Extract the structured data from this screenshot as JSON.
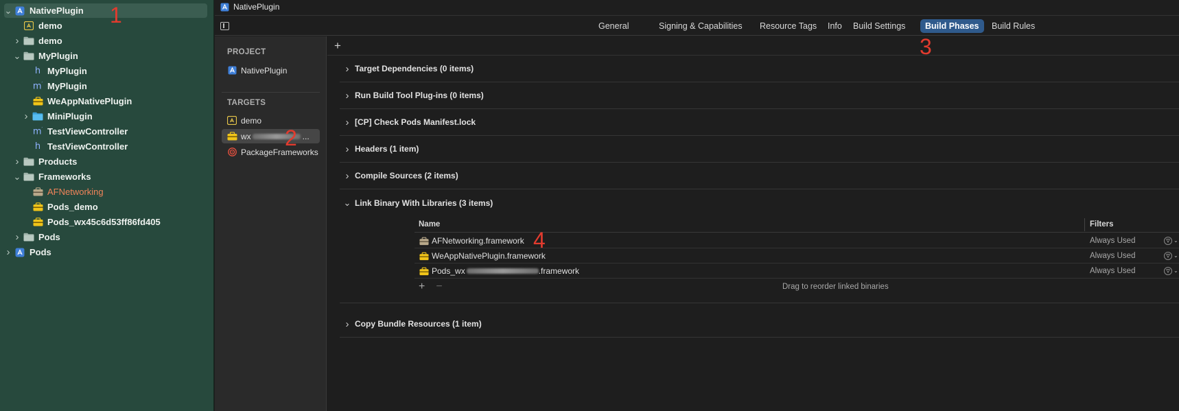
{
  "navigator": {
    "rows": [
      {
        "label": "NativePlugin",
        "chev": "down",
        "icon": "xcode-project-icon",
        "bold": true,
        "selected": true
      },
      {
        "label": "demo",
        "chev": "",
        "icon": "app-target-icon",
        "bold": true
      },
      {
        "label": "demo",
        "chev": "right",
        "icon": "folder-icon",
        "bold": true
      },
      {
        "label": "MyPlugin",
        "chev": "down",
        "icon": "folder-icon",
        "bold": true
      },
      {
        "label": "MyPlugin",
        "chev": "",
        "icon": "header-file-icon",
        "bold": true
      },
      {
        "label": "MyPlugin",
        "chev": "",
        "icon": "objc-file-icon",
        "bold": true
      },
      {
        "label": "WeAppNativePlugin",
        "chev": "",
        "icon": "framework-icon",
        "bold": true
      },
      {
        "label": "MiniPlugin",
        "chev": "right",
        "icon": "blue-folder-icon",
        "bold": true
      },
      {
        "label": "TestViewController",
        "chev": "",
        "icon": "objc-file-icon",
        "bold": true
      },
      {
        "label": "TestViewController",
        "chev": "",
        "icon": "header-file-icon",
        "bold": true
      },
      {
        "label": "Products",
        "chev": "right",
        "icon": "folder-icon",
        "bold": true
      },
      {
        "label": "Frameworks",
        "chev": "down",
        "icon": "folder-icon",
        "bold": true
      },
      {
        "label": "AFNetworking",
        "chev": "",
        "icon": "framework-gray-icon",
        "bold": false,
        "orange": true
      },
      {
        "label": "Pods_demo",
        "chev": "",
        "icon": "framework-icon",
        "bold": true
      },
      {
        "label": "Pods_wx45c6d53ff86fd405",
        "chev": "",
        "icon": "framework-icon",
        "bold": true
      },
      {
        "label": "Pods",
        "chev": "right",
        "icon": "folder-icon",
        "bold": true
      },
      {
        "label": "Pods",
        "chev": "right",
        "icon": "xcode-project-icon",
        "bold": true
      }
    ]
  },
  "header": {
    "title": "NativePlugin",
    "tabs": [
      "General",
      "Signing & Capabilities",
      "Resource Tags",
      "Info",
      "Build Settings",
      "Build Phases",
      "Build Rules"
    ],
    "active_tab": "Build Phases"
  },
  "targets_panel": {
    "project_heading": "PROJECT",
    "project_item": "NativePlugin",
    "targets_heading": "TARGETS",
    "targets": [
      {
        "label": "demo",
        "icon": "app-target-icon",
        "selected": false
      },
      {
        "label": "wx",
        "icon": "framework-icon",
        "selected": true,
        "redacted": true,
        "suffix": "..."
      },
      {
        "label": "PackageFrameworks",
        "icon": "aggregate-target-icon",
        "selected": false
      }
    ]
  },
  "build_phases": {
    "add_label": "+",
    "phases": [
      {
        "label": "Target Dependencies (0 items)",
        "expanded": false
      },
      {
        "label": "Run Build Tool Plug-ins (0 items)",
        "expanded": false
      },
      {
        "label": "[CP] Check Pods Manifest.lock",
        "expanded": false
      },
      {
        "label": "Headers (1 item)",
        "expanded": false
      },
      {
        "label": "Compile Sources (2 items)",
        "expanded": false
      },
      {
        "label": "Link Binary With Libraries (3 items)",
        "expanded": true
      },
      {
        "label": "Copy Bundle Resources (1 item)",
        "expanded": false
      }
    ],
    "link_table": {
      "col_name": "Name",
      "col_filters": "Filters",
      "rows": [
        {
          "name": "AFNetworking.framework",
          "status": "Always Used",
          "icon": "framework-gray-icon"
        },
        {
          "name": "WeAppNativePlugin.framework",
          "status": "Always Used",
          "icon": "framework-icon"
        },
        {
          "name": "Pods_wx",
          "name_suffix": ".framework",
          "status": "Always Used",
          "icon": "framework-icon",
          "redacted": true
        }
      ],
      "add": "+",
      "remove": "−",
      "hint": "Drag to reorder linked binaries"
    }
  },
  "annotations": [
    "1",
    "2",
    "3",
    "4"
  ],
  "colors": {
    "navigator_bg": "#27493d",
    "active_tab": "#2f5a8c",
    "annotation": "#e23b2e",
    "framework_yellow": "#f0c419"
  }
}
